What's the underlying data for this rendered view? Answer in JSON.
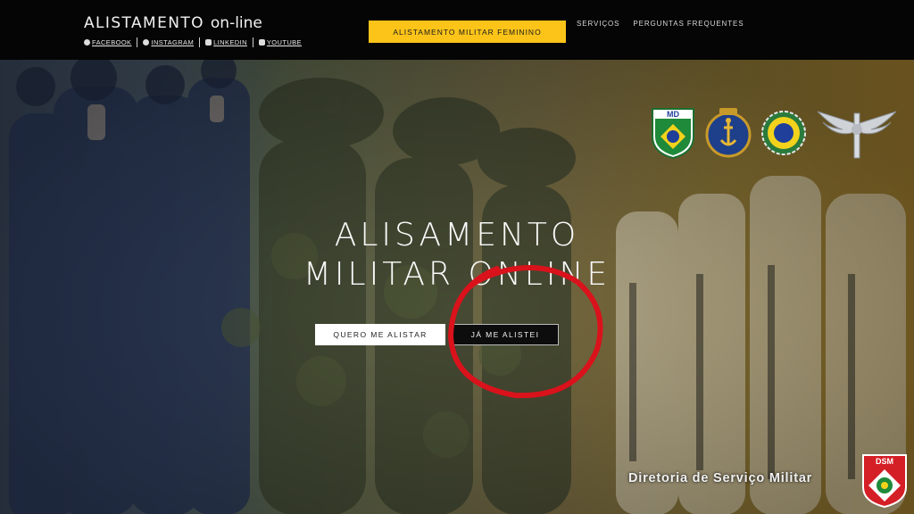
{
  "header": {
    "brand_main": "ALISTAMENTO",
    "brand_sub": "on-line",
    "social": [
      {
        "label": "FACEBOOK",
        "icon": "facebook-icon"
      },
      {
        "label": "INSTAGRAM",
        "icon": "instagram-icon"
      },
      {
        "label": "LINKEDIN",
        "icon": "linkedin-icon"
      },
      {
        "label": "YOUTUBE",
        "icon": "youtube-icon"
      }
    ],
    "cta_female": "ALISTAMENTO MILITAR FEMININO",
    "nav": [
      "SERVIÇOS",
      "PERGUNTAS FREQUENTES"
    ]
  },
  "hero": {
    "title_line1": "ALISAMENTO",
    "title_line2": "MILITAR ONLINE",
    "btn_enlist": "QUERO ME ALISTAR",
    "btn_enlisted": "JÁ ME ALISTEI",
    "emblems": [
      "md-emblem",
      "marinha-emblem",
      "exercito-emblem",
      "aeronautica-emblem"
    ],
    "emblem_md_text": "MD",
    "footer_org": "Diretoria de Serviço Militar",
    "badge_text": "DSM"
  },
  "colors": {
    "accent": "#fcc419",
    "annotation": "#d9121b"
  }
}
